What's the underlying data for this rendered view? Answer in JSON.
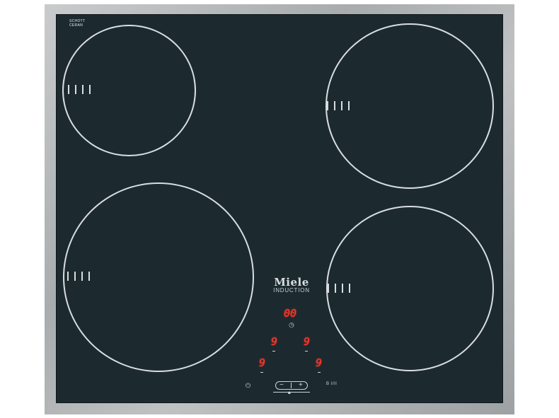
{
  "brand": {
    "schott_line1": "SCHOTT",
    "schott_line2": "CERAN",
    "logo": "Miele",
    "sub": "INDUCTION"
  },
  "controls": {
    "timer_display": "00",
    "timer_icon": "clock-icon",
    "zone_levels": [
      "9",
      "9",
      "9",
      "9"
    ],
    "power_icon": "power-icon",
    "minus": "−",
    "plus": "+",
    "lock_icon": "lock-icon",
    "booster_label": "B I/II"
  },
  "colors": {
    "glass": "#1c2a30",
    "frame": "#b3b6b8",
    "display_red": "#ff3b2f",
    "lines": "#d9dde0"
  }
}
